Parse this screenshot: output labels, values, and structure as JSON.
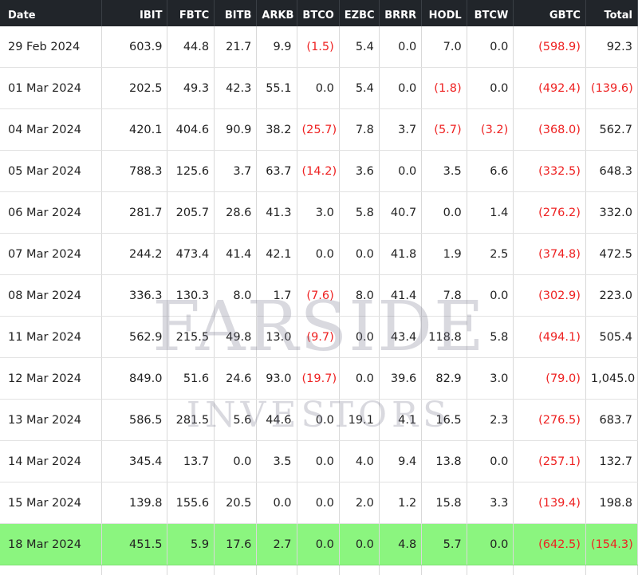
{
  "watermark": {
    "line1": "FARSIDE",
    "line2": "INVESTORS"
  },
  "colors": {
    "header_bg": "#21252a",
    "negative": "#ee2222",
    "highlight_row": "#8bf57f"
  },
  "table": {
    "headers": [
      "Date",
      "IBIT",
      "FBTC",
      "BITB",
      "ARKB",
      "BTCO",
      "EZBC",
      "BRRR",
      "HODL",
      "BTCW",
      "GBTC",
      "Total"
    ],
    "rows": [
      [
        "29 Feb 2024",
        "603.9",
        "44.8",
        "21.7",
        "9.9",
        "(1.5)",
        "5.4",
        "0.0",
        "7.0",
        "0.0",
        "(598.9)",
        "92.3"
      ],
      [
        "01 Mar 2024",
        "202.5",
        "49.3",
        "42.3",
        "55.1",
        "0.0",
        "5.4",
        "0.0",
        "(1.8)",
        "0.0",
        "(492.4)",
        "(139.6)"
      ],
      [
        "04 Mar 2024",
        "420.1",
        "404.6",
        "90.9",
        "38.2",
        "(25.7)",
        "7.8",
        "3.7",
        "(5.7)",
        "(3.2)",
        "(368.0)",
        "562.7"
      ],
      [
        "05 Mar 2024",
        "788.3",
        "125.6",
        "3.7",
        "63.7",
        "(14.2)",
        "3.6",
        "0.0",
        "3.5",
        "6.6",
        "(332.5)",
        "648.3"
      ],
      [
        "06 Mar 2024",
        "281.7",
        "205.7",
        "28.6",
        "41.3",
        "3.0",
        "5.8",
        "40.7",
        "0.0",
        "1.4",
        "(276.2)",
        "332.0"
      ],
      [
        "07 Mar 2024",
        "244.2",
        "473.4",
        "41.4",
        "42.1",
        "0.0",
        "0.0",
        "41.8",
        "1.9",
        "2.5",
        "(374.8)",
        "472.5"
      ],
      [
        "08 Mar 2024",
        "336.3",
        "130.3",
        "8.0",
        "1.7",
        "(7.6)",
        "8.0",
        "41.4",
        "7.8",
        "0.0",
        "(302.9)",
        "223.0"
      ],
      [
        "11 Mar 2024",
        "562.9",
        "215.5",
        "49.8",
        "13.0",
        "(9.7)",
        "0.0",
        "43.4",
        "118.8",
        "5.8",
        "(494.1)",
        "505.4"
      ],
      [
        "12 Mar 2024",
        "849.0",
        "51.6",
        "24.6",
        "93.0",
        "(19.7)",
        "0.0",
        "39.6",
        "82.9",
        "3.0",
        "(79.0)",
        "1,045.0"
      ],
      [
        "13 Mar 2024",
        "586.5",
        "281.5",
        "5.6",
        "44.6",
        "0.0",
        "19.1",
        "4.1",
        "16.5",
        "2.3",
        "(276.5)",
        "683.7"
      ],
      [
        "14 Mar 2024",
        "345.4",
        "13.7",
        "0.0",
        "3.5",
        "0.0",
        "4.0",
        "9.4",
        "13.8",
        "0.0",
        "(257.1)",
        "132.7"
      ],
      [
        "15 Mar 2024",
        "139.8",
        "155.6",
        "20.5",
        "0.0",
        "0.0",
        "2.0",
        "1.2",
        "15.8",
        "3.3",
        "(139.4)",
        "198.8"
      ],
      [
        "18 Mar 2024",
        "451.5",
        "5.9",
        "17.6",
        "2.7",
        "0.0",
        "0.0",
        "4.8",
        "5.7",
        "0.0",
        "(642.5)",
        "(154.3)"
      ]
    ],
    "highlight_row_index": 12
  }
}
